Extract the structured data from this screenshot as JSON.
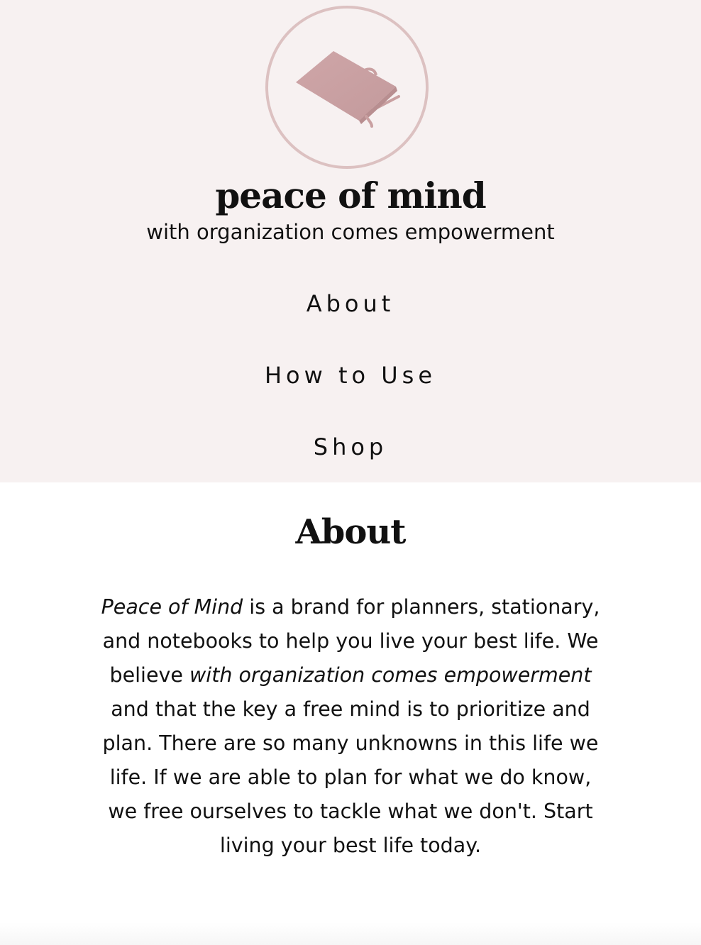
{
  "brand": {
    "title": "peace of mind",
    "tagline": "with organization comes empowerment",
    "logo_icon": "notebook-icon"
  },
  "nav": {
    "items": [
      {
        "label": "About"
      },
      {
        "label": "How to Use"
      },
      {
        "label": "Shop"
      }
    ]
  },
  "about": {
    "heading": "About",
    "brand_name": "Peace of Mind",
    "text_1": " is a brand for planners, stationary, and notebooks to help you live your best life. We believe ",
    "motto": "with organization comes empowerment",
    "text_2": " and that the key a free mind is to prioritize and plan. There are so many unknowns in this life we life. If we are able to plan for what we do know, we free ourselves to tackle what we don't. Start living your best life today."
  },
  "colors": {
    "header_background": "#f7f1f1",
    "accent": "#c9a0a1",
    "logo_ring": "#dcc1c1"
  }
}
